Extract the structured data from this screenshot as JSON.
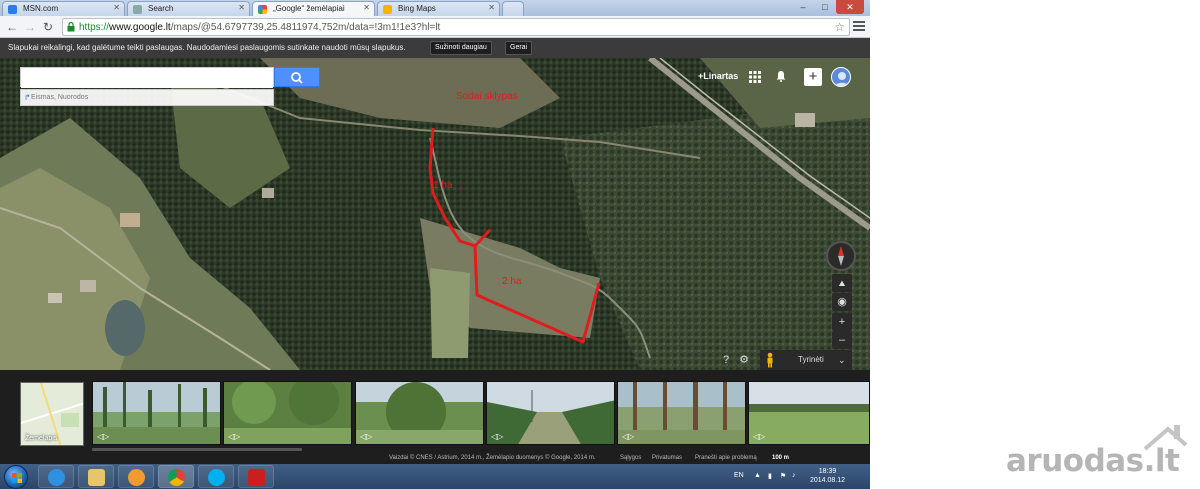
{
  "browser": {
    "tabs": [
      {
        "label": "MSN.com",
        "active": false
      },
      {
        "label": "Search",
        "active": false
      },
      {
        "label": "„Google“ žemėlapiai",
        "active": true
      },
      {
        "label": "Bing Maps",
        "active": false
      }
    ],
    "window_controls": {
      "minimize": "–",
      "maximize": "□",
      "close": "✕"
    },
    "url_scheme": "https://",
    "url_host": "www.google.lt",
    "url_path": "/maps/@54.6797739,25.4811974,752m/data=!3m1!1e3?hl=lt"
  },
  "cookie_bar": {
    "message": "Slapukai reikalingi, kad galėtume teikti paslaugas. Naudodamiesi paslaugomis sutinkate naudoti mūsų slapukus.",
    "learn_more": "Sužinoti daugiau",
    "ok": "Gerai"
  },
  "search": {
    "value": "",
    "directions_label": "Eismas, Nuorodos"
  },
  "account": {
    "plus_name": "+Linartas"
  },
  "map": {
    "type": "satellite",
    "annotations": {
      "top": "Sodai   sklypas",
      "first": "1 ha",
      "second": "2 ha"
    },
    "annotation_color": "#e01c1c",
    "explore_label": "Tyrinėti"
  },
  "photo_strip": {
    "minimap_label": "Žemėlapis",
    "thumbnail_count": 6
  },
  "footer": {
    "imagery": "Vaizdai © CNES / Astrium, 2014 m., Žemėlapio duomenys © Google, 2014 m.",
    "terms": "Sąlygos",
    "privacy": "Privatumas",
    "report": "Pranešti apie problemą",
    "scale": "100 m"
  },
  "taskbar": {
    "language": "EN",
    "time": "18:39",
    "date": "2014.08.12"
  },
  "watermark": {
    "text": "aruodas.lt"
  }
}
